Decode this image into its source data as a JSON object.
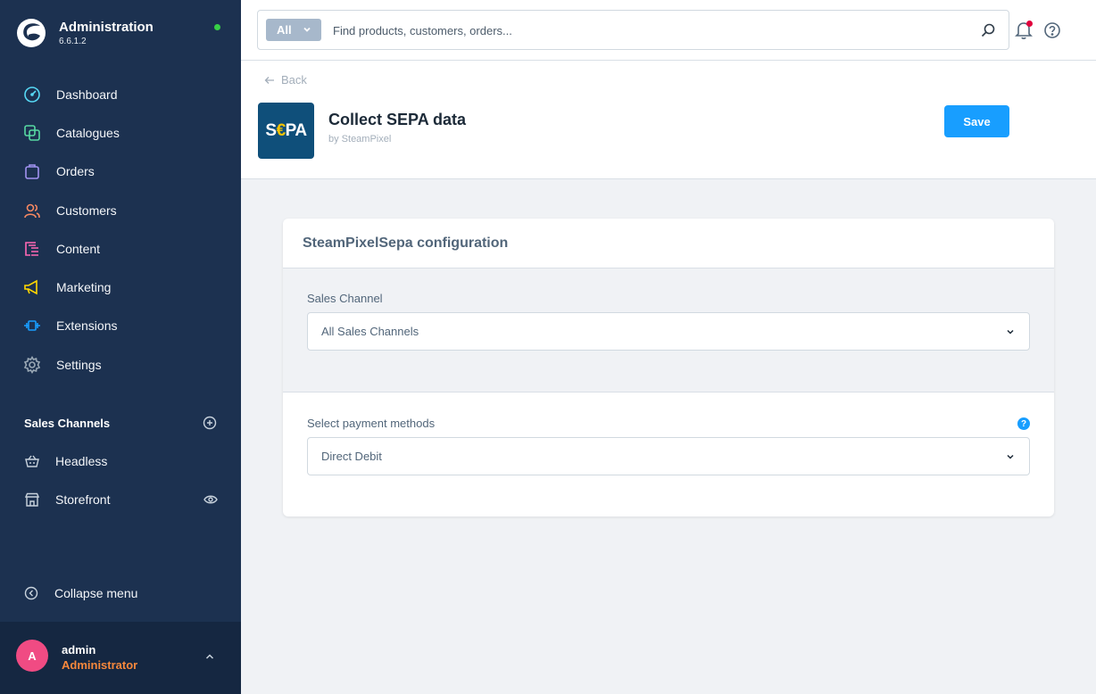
{
  "app": {
    "title": "Administration",
    "version": "6.6.1.2"
  },
  "sidebar": {
    "items": [
      {
        "label": "Dashboard",
        "icon": "dashboard-icon",
        "color": "#57d9f5"
      },
      {
        "label": "Catalogues",
        "icon": "catalogue-icon",
        "color": "#57d9a3"
      },
      {
        "label": "Orders",
        "icon": "orders-icon",
        "color": "#a092f0"
      },
      {
        "label": "Customers",
        "icon": "customers-icon",
        "color": "#f88962"
      },
      {
        "label": "Content",
        "icon": "content-icon",
        "color": "#ff68b4"
      },
      {
        "label": "Marketing",
        "icon": "marketing-icon",
        "color": "#ffd700"
      },
      {
        "label": "Extensions",
        "icon": "extensions-icon",
        "color": "#189eff"
      },
      {
        "label": "Settings",
        "icon": "settings-icon",
        "color": "#9aa8b5"
      }
    ],
    "sales_channels_title": "Sales Channels",
    "sales_channels": [
      {
        "label": "Headless",
        "icon": "basket-icon"
      },
      {
        "label": "Storefront",
        "icon": "storefront-icon"
      }
    ],
    "collapse_label": "Collapse menu"
  },
  "user": {
    "initial": "A",
    "name": "admin",
    "role": "Administrator"
  },
  "search": {
    "type_label": "All",
    "placeholder": "Find products, customers, orders..."
  },
  "page": {
    "back_label": "Back",
    "logo_text_a": "S",
    "logo_text_b": "€",
    "logo_text_c": "PA",
    "title": "Collect SEPA data",
    "author": "by SteamPixel",
    "save_label": "Save"
  },
  "config": {
    "card_title": "SteamPixelSepa configuration",
    "sales_channel_label": "Sales Channel",
    "sales_channel_value": "All Sales Channels",
    "payment_methods_label": "Select payment methods",
    "payment_methods_value": "Direct Debit",
    "help_badge": "?"
  },
  "colors": {
    "sidebar_bg": "#1c3150",
    "accent": "#189eff",
    "online": "#37d046"
  }
}
